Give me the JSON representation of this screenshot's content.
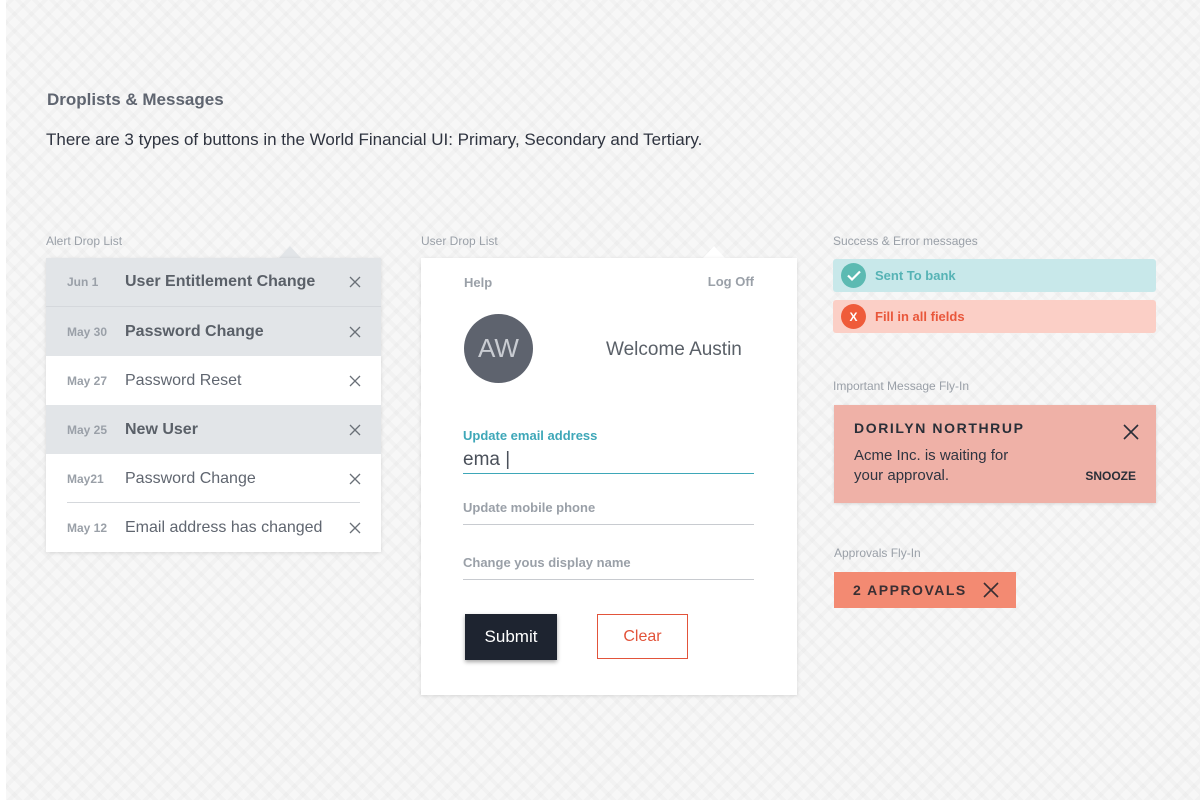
{
  "header": {
    "title": "Droplists & Messages",
    "description": "There are 3 types of buttons in the World Financial UI: Primary, Secondary and Tertiary."
  },
  "alert_list": {
    "label": "Alert Drop List",
    "items": [
      {
        "date": "Jun 1",
        "text": "User Entitlement Change",
        "unread": true
      },
      {
        "date": "May 30",
        "text": "Password Change",
        "unread": true
      },
      {
        "date": "May 27",
        "text": "Password Reset",
        "unread": false
      },
      {
        "date": "May 25",
        "text": "New User",
        "unread": true
      },
      {
        "date": "May21",
        "text": "Password Change",
        "unread": false
      },
      {
        "date": "May 12",
        "text": "Email address has changed",
        "unread": false
      }
    ]
  },
  "user_list": {
    "label": "User Drop List",
    "help": "Help",
    "log_off": "Log Off",
    "avatar_initials": "AW",
    "welcome": "Welcome Austin",
    "email_label": "Update email address",
    "email_value": "ema |",
    "mobile_placeholder": "Update mobile phone",
    "display_name_placeholder": "Change yous display name",
    "submit_label": "Submit",
    "clear_label": "Clear"
  },
  "messages": {
    "label": "Success & Error messages",
    "success_text": "Sent To bank",
    "error_icon": "X",
    "error_text": "Fill in all fields"
  },
  "important_flyin": {
    "label": "Important Message Fly-In",
    "name": "DORILYN NORTHRUP",
    "body": "Acme Inc. is waiting for your approval.",
    "snooze": "SNOOZE"
  },
  "approvals_flyin": {
    "label": "Approvals Fly-In",
    "text": "2 APPROVALS"
  },
  "colors": {
    "accent_teal": "#3ea7b8",
    "error_red": "#e2533a",
    "dark_navy": "#1e2430"
  }
}
